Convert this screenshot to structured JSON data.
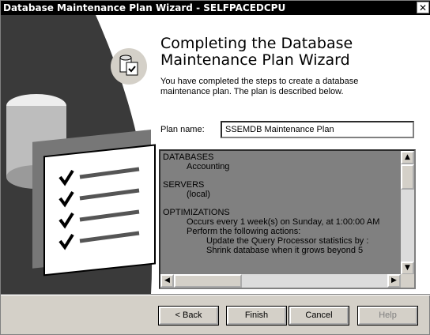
{
  "window": {
    "title": "Database Maintenance Plan Wizard - SELFPACEDCPU",
    "close_glyph": "✕"
  },
  "header": {
    "title_line1": "Completing the Database",
    "title_line2": "Maintenance Plan Wizard",
    "description": "You have completed the steps to create a database maintenance plan. The plan is described below."
  },
  "plan": {
    "label": "Plan name:",
    "value": "SSEMDB Maintenance Plan"
  },
  "summary": {
    "lines": [
      {
        "text": "DATABASES",
        "indent": 0
      },
      {
        "text": "Accounting",
        "indent": 1
      },
      {
        "text": "",
        "indent": 0
      },
      {
        "text": "SERVERS",
        "indent": 0
      },
      {
        "text": "(local)",
        "indent": 1
      },
      {
        "text": "",
        "indent": 0
      },
      {
        "text": "OPTIMIZATIONS",
        "indent": 0
      },
      {
        "text": "Occurs every 1 week(s) on Sunday, at 1:00:00 AM",
        "indent": 1
      },
      {
        "text": "Perform the following actions:",
        "indent": 1
      },
      {
        "text": "Update the Query Processor statistics by :",
        "indent": 2
      },
      {
        "text": "Shrink database when it grows beyond 5",
        "indent": 2
      }
    ]
  },
  "buttons": {
    "back": "< Back",
    "finish": "Finish",
    "cancel": "Cancel",
    "help": "Help"
  }
}
